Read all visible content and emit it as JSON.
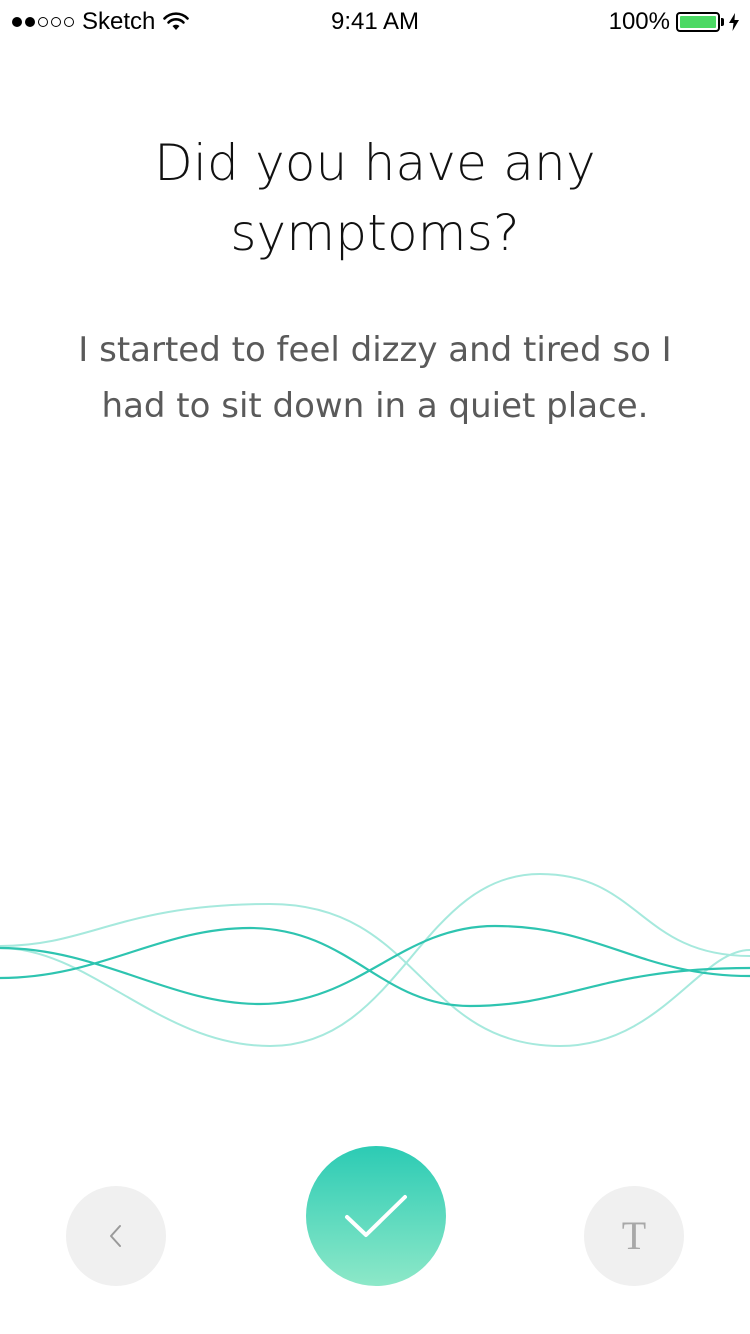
{
  "status_bar": {
    "signal_filled": 2,
    "signal_total": 5,
    "carrier": "Sketch",
    "wifi_icon": "wifi-icon",
    "time": "9:41 AM",
    "battery_percent": "100%",
    "battery_level": 1.0,
    "battery_color": "#4cd964",
    "charging_icon": "bolt-icon"
  },
  "question": {
    "line1": "Did you have any",
    "line2": "symptoms?"
  },
  "answer": {
    "line1": "I started to feel dizzy and tired so I",
    "line2": "had to sit down in a quiet place."
  },
  "waveform": {
    "icon": "voice-waveform",
    "color_primary": "#2ec4b0",
    "color_light": "#a6e9dd"
  },
  "controls": {
    "back_icon": "chevron-left-icon",
    "confirm_icon": "checkmark-icon",
    "text_mode_label": "T",
    "accent_top": "#2ccbb4",
    "accent_bottom": "#8de8c8"
  }
}
